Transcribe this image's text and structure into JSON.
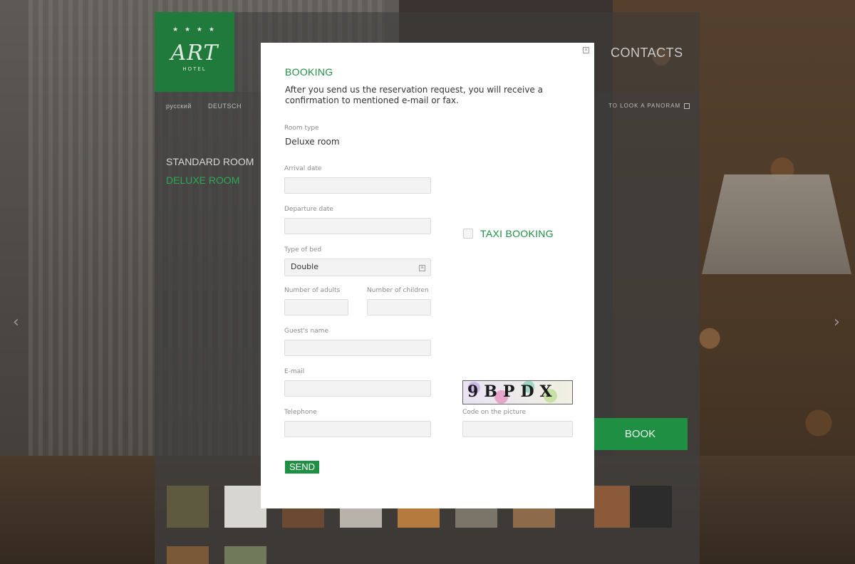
{
  "header": {
    "logo_word": "ART",
    "logo_stars": "★ ★ ★ ★",
    "logo_sub": "HOTEL",
    "contacts": "CONTACTS"
  },
  "languages": [
    "русский",
    "DEUTSCH"
  ],
  "panorama_link": "TO LOOK A PANORAM",
  "rooms": {
    "standard": "STANDARD ROOM",
    "deluxe": "DELUXE ROOM"
  },
  "book_label": "BOOK",
  "nav": {
    "prev": "‹",
    "next": "›"
  },
  "modal": {
    "title": "BOOKING",
    "intro": "After you send us the reservation request, you will receive a confirmation to mentioned e-mail or fax.",
    "room_type_label": "Room type",
    "room_type_value": "Deluxe room",
    "arrival_label": "Arrival date",
    "departure_label": "Departure date",
    "bed_label": "Type of bed",
    "bed_value": "Double",
    "adults_label": "Number of adults",
    "children_label": "Number of children",
    "guest_label": "Guest's name",
    "email_label": "E-mail",
    "telephone_label": "Telephone",
    "taxi_label": "TAXI BOOKING",
    "captcha_text": "9BPDX",
    "code_label": "Code on the picture",
    "send_label": "SEND",
    "close_icon": "close-icon"
  },
  "colors": {
    "accent_green": "#1f8f44",
    "modal_bg": "#ffffff"
  }
}
